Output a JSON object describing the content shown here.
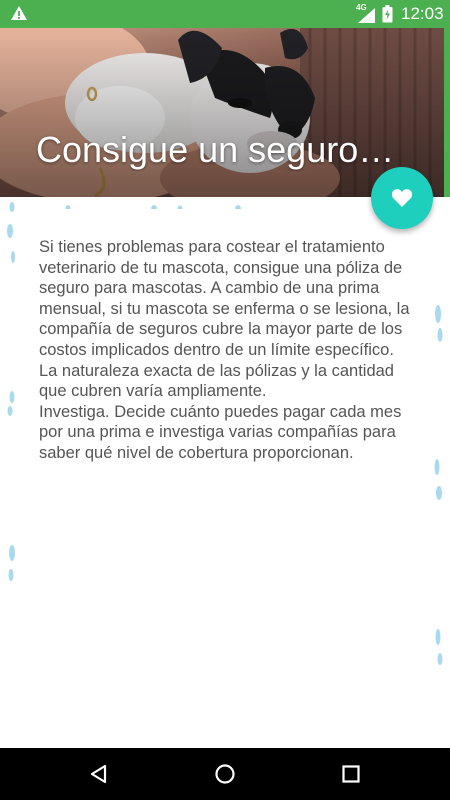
{
  "status_bar": {
    "network_label": "4G",
    "time": "12:03",
    "icons": [
      "warning-icon",
      "signal-icon",
      "battery-charging-icon"
    ],
    "background_color": "#4caf50"
  },
  "hero": {
    "title": "Consigue un seguro…",
    "image_subject": "puppy-in-arms"
  },
  "fab": {
    "icon": "heart-icon",
    "color": "#1ecfbd"
  },
  "article": {
    "paragraphs": [
      "Si tienes problemas para costear el tratamiento veterinario de tu mascota, consigue una póliza de seguro para mascotas. A cambio de una prima mensual, si tu mascota se enferma o se lesiona, la compañía de seguros cubre la mayor parte de los costos implicados dentro de un límite específico. La naturaleza exacta de las pólizas y la cantidad que cubren varía ampliamente.",
      "Investiga. Decide cuánto puedes pagar cada mes por una prima e investiga varias compañías para saber qué nivel de cobertura proporcionan."
    ]
  },
  "nav_bar": {
    "buttons": [
      "back-icon",
      "home-icon",
      "recents-icon"
    ]
  }
}
